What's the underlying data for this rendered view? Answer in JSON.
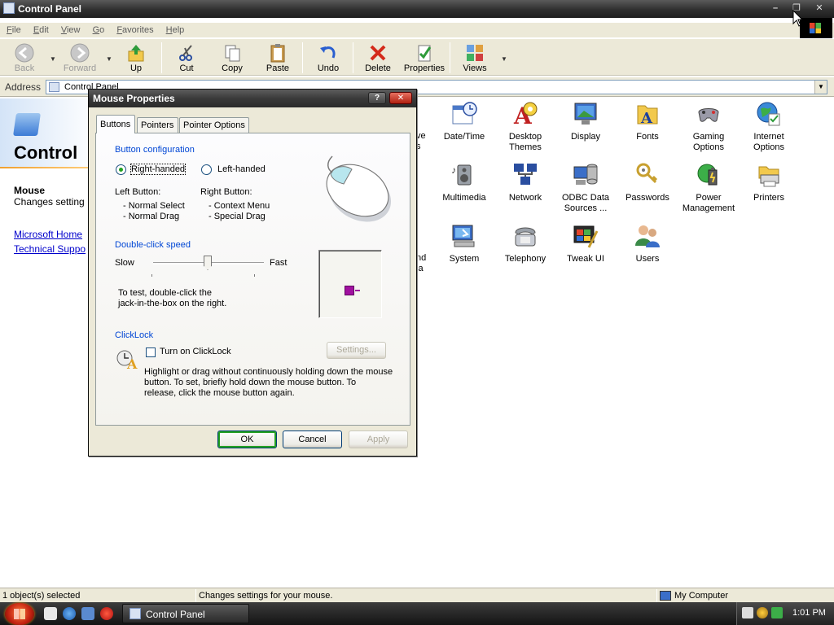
{
  "window": {
    "title": "Control Panel",
    "menu": [
      "File",
      "Edit",
      "View",
      "Go",
      "Favorites",
      "Help"
    ]
  },
  "toolbar": {
    "back": "Back",
    "forward": "Forward",
    "up": "Up",
    "cut": "Cut",
    "copy": "Copy",
    "paste": "Paste",
    "undo": "Undo",
    "delete": "Delete",
    "properties": "Properties",
    "views": "Views"
  },
  "address": {
    "label": "Address",
    "value": "Control Panel"
  },
  "left_panel": {
    "title": "Control",
    "selected_name": "Mouse",
    "selected_desc": "Changes setting",
    "links": [
      "Microsoft Home",
      "Technical Suppo"
    ]
  },
  "icons": {
    "row1": [
      "Date/Time",
      "Desktop Themes",
      "Display",
      "Fonts",
      "Gaming Options",
      "Internet Options"
    ],
    "row2": [
      "Multimedia",
      "Network",
      "ODBC Data Sources ...",
      "Passwords",
      "Power Management",
      "Printers"
    ],
    "row3": [
      "System",
      "Telephony",
      "Tweak UI",
      "Users"
    ],
    "partial": [
      "ve",
      "s",
      "nd",
      "ia"
    ]
  },
  "statusbar": {
    "left": "1 object(s) selected",
    "center": "Changes settings for your mouse.",
    "right": "My Computer"
  },
  "taskbar": {
    "task": "Control Panel",
    "clock": "1:01 PM"
  },
  "dialog": {
    "title": "Mouse Properties",
    "help_glyph": "?",
    "close_glyph": "✕",
    "tabs": [
      "Buttons",
      "Pointers",
      "Pointer Options"
    ],
    "button_config": {
      "heading": "Button configuration",
      "right_handed": "Right-handed",
      "left_handed": "Left-handed",
      "left_button_label": "Left Button:",
      "left_button_items": [
        "- Normal Select",
        "- Normal Drag"
      ],
      "right_button_label": "Right Button:",
      "right_button_items": [
        "- Context Menu",
        "- Special Drag"
      ]
    },
    "double_click": {
      "heading": "Double-click speed",
      "slow": "Slow",
      "fast": "Fast",
      "hint_line1": "To test, double-click the",
      "hint_line2": "jack-in-the-box on the right."
    },
    "clicklock": {
      "heading": "ClickLock",
      "checkbox_label": "Turn on ClickLock",
      "settings_button": "Settings...",
      "desc_line1": "Highlight or drag without continuously holding down the mouse",
      "desc_line2": "button. To set, briefly hold down the mouse button. To",
      "desc_line3": "release, click the mouse button again."
    },
    "buttons": {
      "ok": "OK",
      "cancel": "Cancel",
      "apply": "Apply"
    }
  }
}
